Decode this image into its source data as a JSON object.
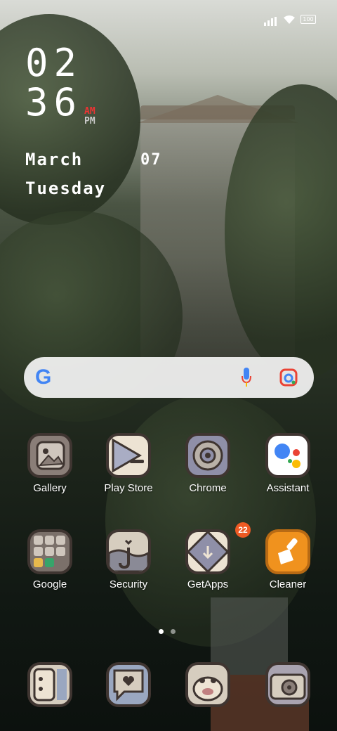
{
  "status_bar": {
    "battery": "100"
  },
  "clock": {
    "hours": "02",
    "minutes": "36",
    "am": "AM",
    "pm": "PM"
  },
  "date": {
    "month": "March",
    "day": "07",
    "weekday": "Tuesday"
  },
  "search": {
    "logo": "G"
  },
  "apps_row1": [
    {
      "label": "Gallery",
      "icon": "gallery-icon"
    },
    {
      "label": "Play Store",
      "icon": "play-store-icon"
    },
    {
      "label": "Chrome",
      "icon": "chrome-icon"
    },
    {
      "label": "Assistant",
      "icon": "assistant-icon"
    }
  ],
  "apps_row2": [
    {
      "label": "Google",
      "icon": "google-folder-icon"
    },
    {
      "label": "Security",
      "icon": "security-icon"
    },
    {
      "label": "GetApps",
      "icon": "getapps-icon",
      "badge": "22"
    },
    {
      "label": "Cleaner",
      "icon": "cleaner-icon"
    }
  ],
  "dock": [
    {
      "icon": "phone-icon"
    },
    {
      "icon": "messages-icon"
    },
    {
      "icon": "contacts-icon"
    },
    {
      "icon": "camera-icon"
    }
  ],
  "colors": {
    "am": "#e33333",
    "badge": "#ee5a24",
    "cleaner": "#f0921e",
    "icon_border": "#3f3531"
  }
}
